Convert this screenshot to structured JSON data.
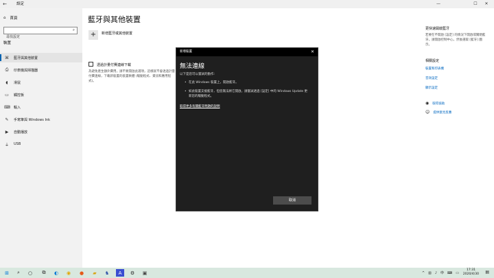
{
  "window": {
    "back_glyph": "←",
    "title": "設定",
    "minimize": "—",
    "maximize": "☐",
    "close": "✕"
  },
  "sidebar": {
    "home_label": "首頁",
    "search_placeholder": "尋找設定",
    "section_label": "裝置",
    "items": [
      {
        "label": "藍牙與其他裝置",
        "icon": "bluetooth-icon",
        "glyph": "⌘"
      },
      {
        "label": "印表機與掃描器",
        "icon": "printer-icon",
        "glyph": "⎙"
      },
      {
        "label": "滑鼠",
        "icon": "mouse-icon",
        "glyph": "⌂"
      },
      {
        "label": "觸控板",
        "icon": "touchpad-icon",
        "glyph": "▭"
      },
      {
        "label": "輸入",
        "icon": "keyboard-icon",
        "glyph": "⌨"
      },
      {
        "label": "手寫筆與 Windows Ink",
        "icon": "pen-icon",
        "glyph": "✎"
      },
      {
        "label": "自動播放",
        "icon": "autoplay-icon",
        "glyph": "▶"
      },
      {
        "label": "USB",
        "icon": "usb-icon",
        "glyph": "⏚"
      }
    ]
  },
  "main": {
    "title": "藍牙與其他裝置",
    "add_device_label": "新增藍牙或其他裝置",
    "metered_label": "透過計量付費連線下載",
    "metered_desc": "為避免產生額外費用，請不要開啟此選項，這樣就不會透過計量付費連線，下載新裝置的裝置軟體 (驅動程式、資訊和應用程式)。"
  },
  "right_pane": {
    "quick_title": "更快速開啟藍牙",
    "quick_text": "若要在不開啟 [設定] 的情況下開啟或關閉藍牙，請開啟控制中心，然後選取 [藍牙] 圖示。",
    "related_title": "相關設定",
    "related_links": [
      "裝置和印表機",
      "音效設定",
      "顯示設定"
    ],
    "help_link": "取得協助",
    "feedback_link": "提供意見反應"
  },
  "dialog": {
    "title": "新增裝置",
    "close": "✕",
    "heading": "無法連線",
    "intro": "以下是您可以嘗試的動作:",
    "bullets": [
      "在此 Windows 裝置上，開啟藍牙。",
      "如此裝置支援藍牙，但您無法將它開啟，請嘗試透過 [設定] 中的 Windows Update 更新您的驅動程式。"
    ],
    "help_link": "取得更多有關藍牙問題的說明",
    "cancel_label": "取消"
  },
  "taskbar": {
    "tray_chevron": "^",
    "clock_time": "17:31",
    "clock_date": "2020/4/30",
    "notification_glyph": "▤"
  }
}
